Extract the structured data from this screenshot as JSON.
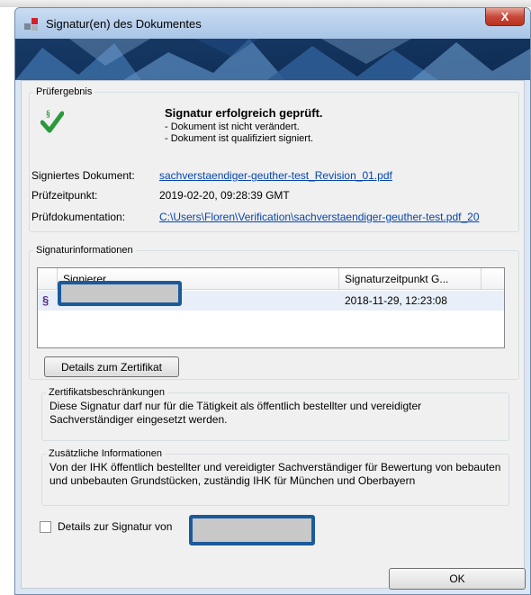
{
  "window": {
    "title": "Signatur(en) des Dokumentes",
    "close_label": "X"
  },
  "pruefergebnis": {
    "legend": "Prüfergebnis",
    "status_title": "Signatur erfolgreich geprüft.",
    "status_lines": [
      "- Dokument ist nicht verändert.",
      "- Dokument ist qualifiziert signiert."
    ],
    "fields": [
      {
        "label": "Signiertes Dokument:",
        "value": "sachverstaendiger-geuther-test_Revision_01.pdf",
        "is_link": true
      },
      {
        "label": "Prüfzeitpunkt:",
        "value": "2019-02-20, 09:28:39 GMT",
        "is_link": false
      },
      {
        "label": "Prüfdokumentation:",
        "value": "C:\\Users\\Floren\\Verification\\sachverstaendiger-geuther-test.pdf_20",
        "is_link": true
      }
    ]
  },
  "signaturinformationen": {
    "legend": "Signaturinformationen",
    "columns": [
      "Signierer",
      "Signaturzeitpunkt G..."
    ],
    "rows": [
      {
        "symbol": "§",
        "signer": "",
        "time": "2018-11-29, 12:23:08"
      }
    ],
    "details_button": "Details zum Zertifikat"
  },
  "zertifikatsbeschraenkungen": {
    "legend": "Zertifikatsbeschränkungen",
    "text": "Diese Signatur darf nur für die Tätigkeit als öffentlich bestellter und vereidigter Sachverständiger eingesetzt werden."
  },
  "zusaetzliche_informationen": {
    "legend": "Zusätzliche Informationen",
    "text": "Von der IHK öffentlich bestellter und vereidigter Sachverständiger für Bewertung von bebauten und unbebauten Grundstücken, zuständig IHK für München und Oberbayern"
  },
  "details_signatur": {
    "label": "Details zur Signatur von",
    "checked": false
  },
  "ok_button": "OK",
  "colors": {
    "accent_blue": "#1b5a9a",
    "link": "#0645ad",
    "check_green": "#2a9a3c",
    "close_red": "#c8483a"
  },
  "icons": [
    "app-icon",
    "signature-check-icon",
    "paragraph-icon",
    "close-icon"
  ]
}
